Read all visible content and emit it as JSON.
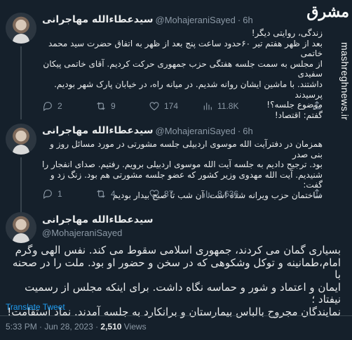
{
  "branding": {
    "logo_text": "مشرق",
    "watermark": "mashreghnews.ir"
  },
  "tweets": [
    {
      "name": "سیدعطاءالله مهاجرانی",
      "handle": "@MohajeraniSayed",
      "time": "6h",
      "text": "زندگی، روایتی دیگر!\nبعد از ظهر هفتم تیر ۶۰حدود ساعت پنج بعد از ظهر به اتفاق حضرت سید محمد خاتمی\nاز مجلس به سمت جلسه هفتگی حزب جمهوری حرکت کردیم. آقای خاتمی پیکان سفیدی\nداشتند. با ماشین ایشان روانه شدیم. در میانه راه، در خیابان پارک شهر بودیم. پرسیدند\nموضوع جلسه؟!\nگفتم: اقتصاد!",
      "replies": "2",
      "retweets": "9",
      "likes": "174",
      "views": "11.8K"
    },
    {
      "name": "سیدعطاءالله مهاجرانی",
      "handle": "@MohajeraniSayed",
      "time": "6h",
      "text": "همزمان در دفترآیت الله موسوی اردبیلی جلسه مشورتی در مورد مسائل روز و بنی صدر\nبود. ترجیح دادیم به جلسه آیت الله موسوی اردبیلی برویم. رفتیم. صدای انفجار را\nشنیدیم. آیت الله مهدوی وزیر کشور که عضو جلسه مشورتی هم بود. زنگ زد و گفت:\nساختمان حزب ویرانه شده است. آن شب تا صبح بیدار بودیم",
      "replies": "1",
      "retweets": "4",
      "likes": "87",
      "views": "8,636"
    }
  ],
  "main_tweet": {
    "name": "سیدعطاءالله مهاجرانی",
    "handle": "@MohajeraniSayed",
    "text": "بسیاری گمان می کردند، جمهوری اسلامی سقوط می کند. نفس الهی وگرم\nامام،طمانینه و توکل وشکوهی که در سخن و حضور او بود. ملت را در صحنه با\nایمان و اعتماد و شور و حماسه نگاه داشت. برای اینکه مجلس از رسمیت نیفتاد ؛\nنمایندگان مجروح بالباس بیمارستان و برانکارد به جلسه آمدند. نماد استقامت!",
    "translate": "Translate Tweet",
    "timestamp": "5:33 PM · Jun 28, 2023 · ",
    "views_count": "2,510",
    "views_label": " Views"
  },
  "icons": [
    "reply-icon",
    "retweet-icon",
    "like-icon",
    "views-icon",
    "share-icon"
  ],
  "colors": {
    "background": "#15202b",
    "text": "#e7e9ea",
    "secondary": "#8b98a5",
    "link": "#1d9bf0",
    "separator": "#38444d"
  }
}
